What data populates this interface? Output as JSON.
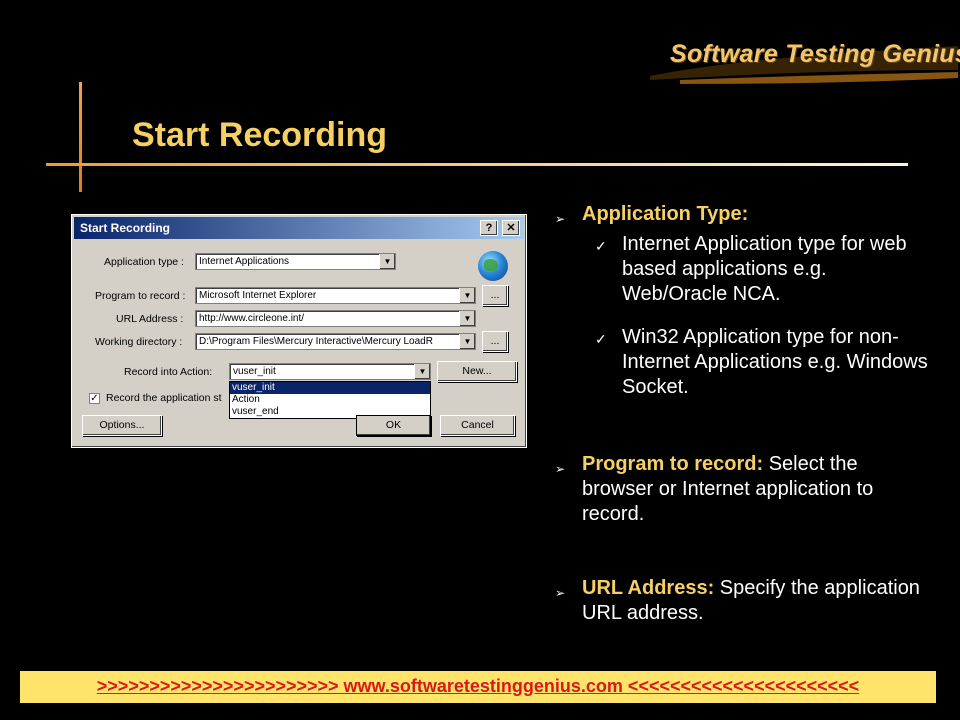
{
  "logo": {
    "text": "Software Testing Genius"
  },
  "slide": {
    "title": "Start Recording"
  },
  "dialog": {
    "title": "Start Recording",
    "help_label": "?",
    "close_label": "✕",
    "fields": {
      "application_type": {
        "label": "Application type :",
        "value": "Internet Applications"
      },
      "program": {
        "label": "Program to record :",
        "value": "Microsoft Internet Explorer"
      },
      "url": {
        "label": "URL Address :",
        "value": "http://www.circleone.int/"
      },
      "working_dir": {
        "label": "Working directory :",
        "value": "D:\\Program Files\\Mercury Interactive\\Mercury LoadR"
      },
      "record_action": {
        "label": "Record into Action:",
        "value": "vuser_init"
      }
    },
    "browse_label": "...",
    "new_label": "New...",
    "action_options": [
      "vuser_init",
      "Action",
      "vuser_end"
    ],
    "checkbox_label": "Record the application st",
    "options_label": "Options...",
    "ok_label": "OK",
    "cancel_label": "Cancel"
  },
  "bullets": {
    "app_type": {
      "key": "Application Type:",
      "subs": [
        "Internet Application type for web based applications e.g. Web/Oracle NCA.",
        "Win32 Application type for non-Internet Applications e.g. Windows Socket."
      ]
    },
    "program": {
      "key": "Program to record:",
      "text": " Select the browser or Internet application to record."
    },
    "url": {
      "key": "URL Address:",
      "text": " Specify the application URL address."
    }
  },
  "footer": {
    "link_text": ">>>>>>>>>>>>>>>>>>>>>>>   www.softwaretestinggenius.com  <<<<<<<<<<<<<<<<<<<<<<"
  },
  "colors": {
    "title": "#f6d063",
    "accent": "#f39a34",
    "footer_bg": "#ffe36b",
    "footer_link": "#d81919"
  }
}
